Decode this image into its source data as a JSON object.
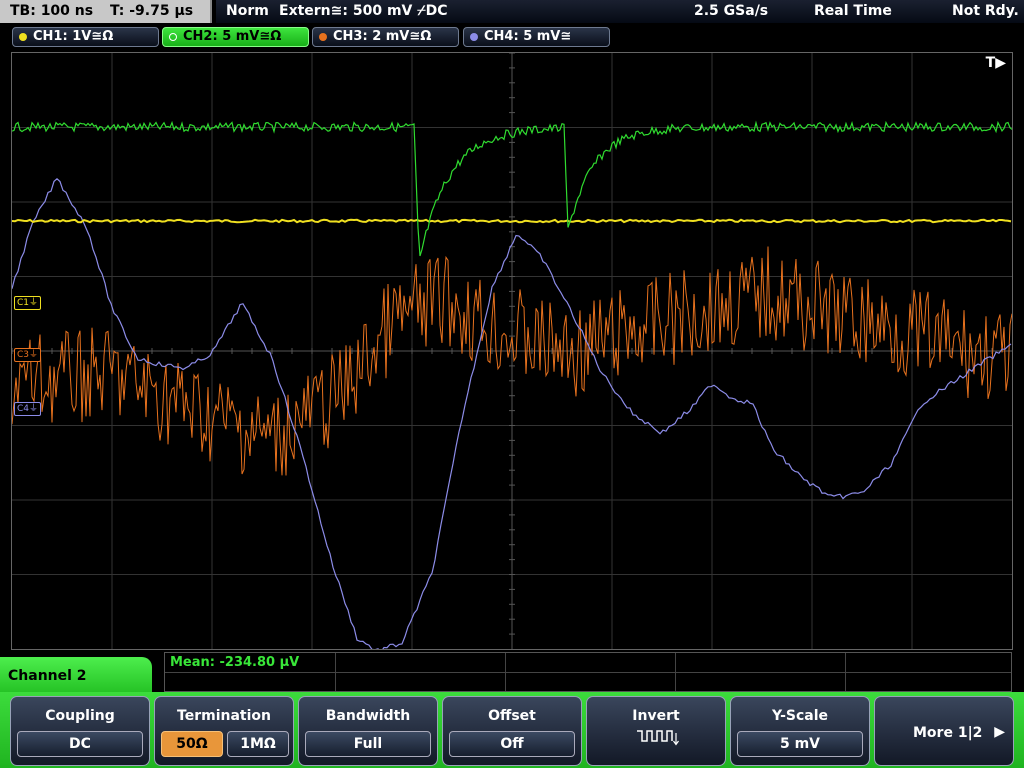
{
  "topbar": {
    "timebase": "TB: 100 ns",
    "trigger_time": "T: -9.75 µs",
    "mode": "Norm",
    "trigger": "Extern≅: 500 mV ⌿DC",
    "sample_rate": "2.5 GSa/s",
    "acquisition": "Real Time",
    "status": "Not Rdy."
  },
  "channels": [
    {
      "label": "CH1: 1V≅Ω",
      "color": "#f0e020",
      "marker": "C1⏚"
    },
    {
      "label": "CH2: 5 mV≅Ω",
      "color": "#30dc30",
      "marker": "C2⏚"
    },
    {
      "label": "CH3: 2 mV≅Ω",
      "color": "#e8721e",
      "marker": "C3⏚"
    },
    {
      "label": "CH4: 5 mV≅",
      "color": "#8c8ce8",
      "marker": "C4⏚"
    }
  ],
  "trigger_marker": "T▶",
  "panel": {
    "title": "Channel 2",
    "measurement": "Mean: -234.80 µV"
  },
  "softkeys": {
    "coupling": {
      "title": "Coupling",
      "value": "DC"
    },
    "termination": {
      "title": "Termination",
      "opt1": "50Ω",
      "opt2": "1MΩ"
    },
    "bandwidth": {
      "title": "Bandwidth",
      "value": "Full"
    },
    "offset": {
      "title": "Offset",
      "value": "Off"
    },
    "invert": {
      "title": "Invert"
    },
    "yscale": {
      "title": "Y-Scale",
      "value": "5 mV"
    },
    "more": {
      "label": "More 1|2"
    }
  },
  "icons": {
    "invert": "inverted-square-wave-icon",
    "more": "right-arrow-icon"
  }
}
